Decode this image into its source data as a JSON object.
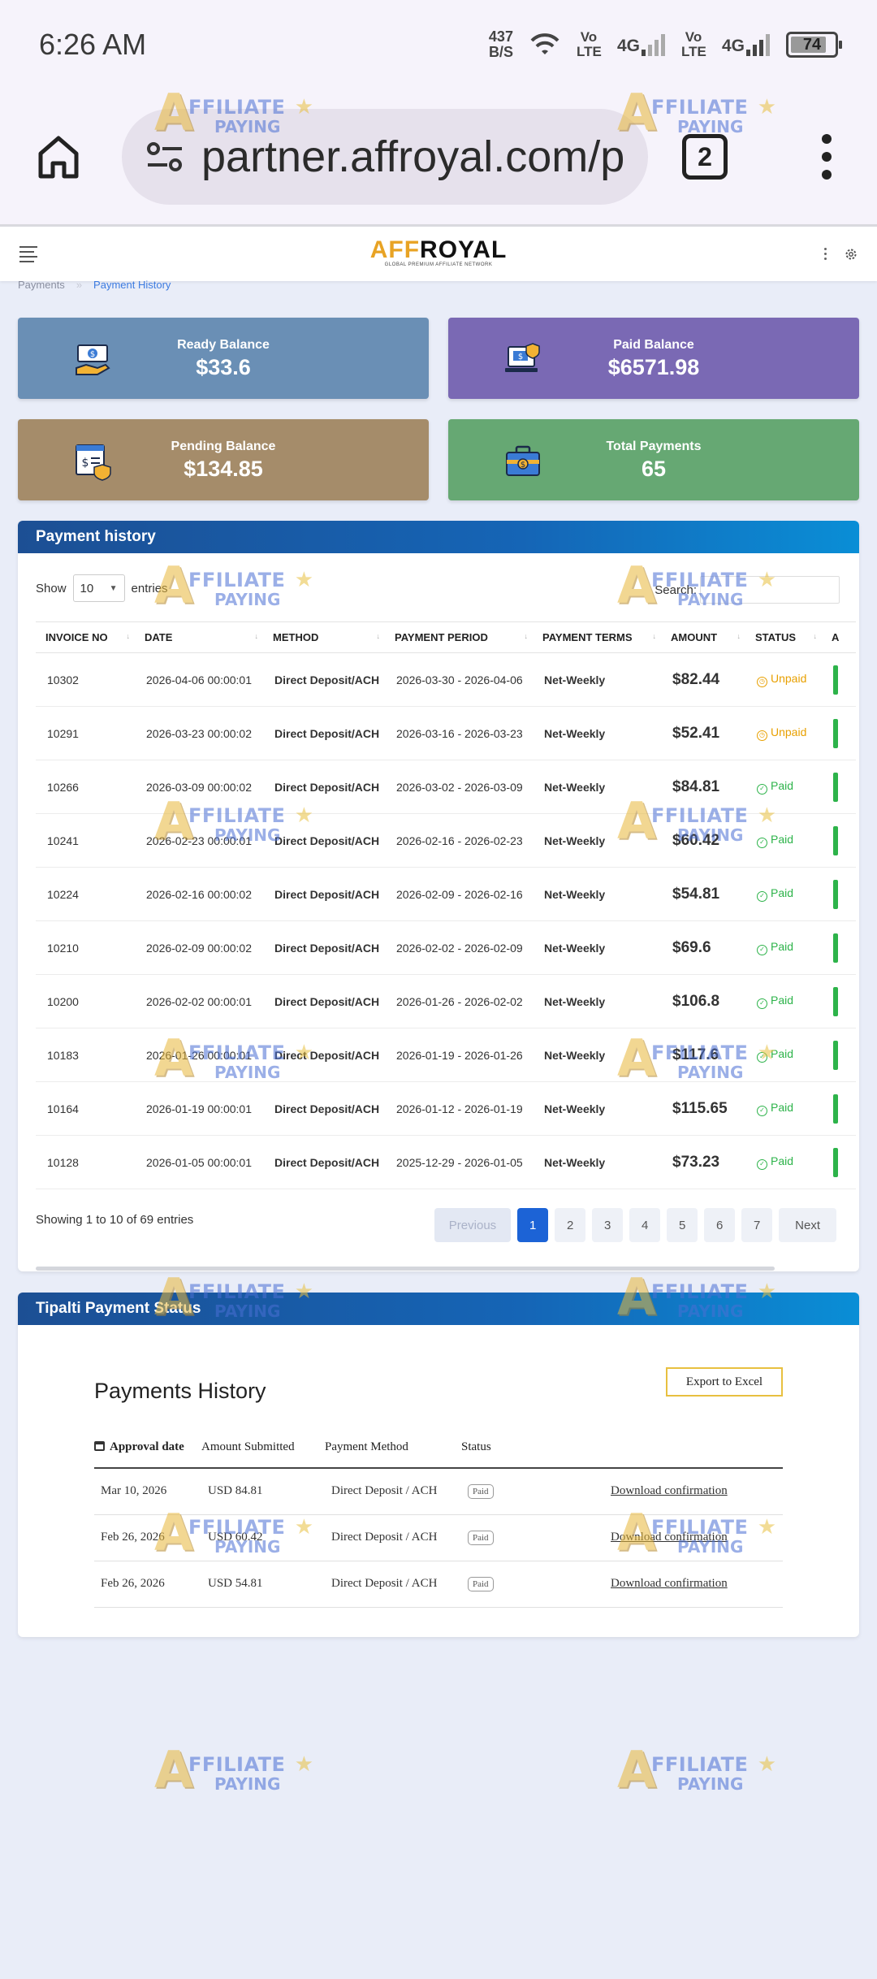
{
  "status_bar": {
    "time": "6:26 AM",
    "net_speed_value": "437",
    "net_speed_unit": "B/S",
    "volte_1": "Vo LTE",
    "network_1": "4G",
    "volte_2": "Vo LTE",
    "network_2": "4G",
    "battery": "74",
    "battery_level": 0.74
  },
  "browser": {
    "url": "partner.affroyal.com/p",
    "tab_count": "2"
  },
  "site": {
    "logo_aff": "AFF",
    "logo_royal": "ROYAL",
    "logo_tagline": "GLOBAL PREMIUM AFFILIATE NETWORK"
  },
  "breadcrumb": {
    "parent": "Payments",
    "current": "Payment History"
  },
  "cards": [
    {
      "label": "Ready Balance",
      "value": "$33.6",
      "color": "#6a8fb5"
    },
    {
      "label": "Paid Balance",
      "value": "$6571.98",
      "color": "#7a69b4"
    },
    {
      "label": "Pending Balance",
      "value": "$134.85",
      "color": "#a58c6a"
    },
    {
      "label": "Total Payments",
      "value": "65",
      "color": "#66a873"
    }
  ],
  "payment_history": {
    "title": "Payment history",
    "show_label": "Show",
    "page_size": "10",
    "entries_label": "entries",
    "search_label": "Search:",
    "columns": [
      "INVOICE NO",
      "DATE",
      "METHOD",
      "PAYMENT PERIOD",
      "PAYMENT TERMS",
      "AMOUNT",
      "STATUS",
      "A"
    ],
    "rows": [
      {
        "invoice": "10302",
        "date": "2026-04-06 00:00:01",
        "method": "Direct Deposit/ACH",
        "period": "2026-03-30 - 2026-04-06",
        "terms": "Net-Weekly",
        "amount": "$82.44",
        "status": "Unpaid"
      },
      {
        "invoice": "10291",
        "date": "2026-03-23 00:00:02",
        "method": "Direct Deposit/ACH",
        "period": "2026-03-16 - 2026-03-23",
        "terms": "Net-Weekly",
        "amount": "$52.41",
        "status": "Unpaid"
      },
      {
        "invoice": "10266",
        "date": "2026-03-09 00:00:02",
        "method": "Direct Deposit/ACH",
        "period": "2026-03-02 - 2026-03-09",
        "terms": "Net-Weekly",
        "amount": "$84.81",
        "status": "Paid"
      },
      {
        "invoice": "10241",
        "date": "2026-02-23 00:00:01",
        "method": "Direct Deposit/ACH",
        "period": "2026-02-16 - 2026-02-23",
        "terms": "Net-Weekly",
        "amount": "$60.42",
        "status": "Paid"
      },
      {
        "invoice": "10224",
        "date": "2026-02-16 00:00:02",
        "method": "Direct Deposit/ACH",
        "period": "2026-02-09 - 2026-02-16",
        "terms": "Net-Weekly",
        "amount": "$54.81",
        "status": "Paid"
      },
      {
        "invoice": "10210",
        "date": "2026-02-09 00:00:02",
        "method": "Direct Deposit/ACH",
        "period": "2026-02-02 - 2026-02-09",
        "terms": "Net-Weekly",
        "amount": "$69.6",
        "status": "Paid"
      },
      {
        "invoice": "10200",
        "date": "2026-02-02 00:00:01",
        "method": "Direct Deposit/ACH",
        "period": "2026-01-26 - 2026-02-02",
        "terms": "Net-Weekly",
        "amount": "$106.8",
        "status": "Paid"
      },
      {
        "invoice": "10183",
        "date": "2026-01-26 00:00:01",
        "method": "Direct Deposit/ACH",
        "period": "2026-01-19 - 2026-01-26",
        "terms": "Net-Weekly",
        "amount": "$117.6",
        "status": "Paid"
      },
      {
        "invoice": "10164",
        "date": "2026-01-19 00:00:01",
        "method": "Direct Deposit/ACH",
        "period": "2026-01-12 - 2026-01-19",
        "terms": "Net-Weekly",
        "amount": "$115.65",
        "status": "Paid"
      },
      {
        "invoice": "10128",
        "date": "2026-01-05 00:00:01",
        "method": "Direct Deposit/ACH",
        "period": "2025-12-29 - 2026-01-05",
        "terms": "Net-Weekly",
        "amount": "$73.23",
        "status": "Paid"
      }
    ],
    "info": "Showing 1 to 10 of 69 entries",
    "pagination": {
      "previous": "Previous",
      "pages": [
        "1",
        "2",
        "3",
        "4",
        "5",
        "6",
        "7"
      ],
      "current": "1",
      "next": "Next"
    }
  },
  "tipalti": {
    "title": "Tipalti Payment Status",
    "heading": "Payments History",
    "export_label": "Export to Excel",
    "columns": [
      "Approval date",
      "Amount Submitted",
      "Payment Method",
      "Status"
    ],
    "rows": [
      {
        "date": "Mar 10, 2026",
        "amount": "USD 84.81",
        "method": "Direct Deposit / ACH",
        "status": "Paid",
        "link": "Download confirmation"
      },
      {
        "date": "Feb 26, 2026",
        "amount": "USD 60.42",
        "method": "Direct Deposit / ACH",
        "status": "Paid",
        "link": "Download confirmation"
      },
      {
        "date": "Feb 26, 2026",
        "amount": "USD 54.81",
        "method": "Direct Deposit / ACH",
        "status": "Paid",
        "link": "Download confirmation"
      }
    ]
  },
  "watermark": {
    "letter": "A",
    "line1": "FFILIATE",
    "line2": "PAYING"
  }
}
